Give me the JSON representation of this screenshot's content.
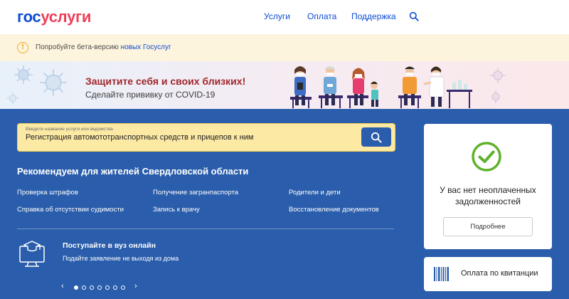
{
  "header": {
    "logo_part1": "гос",
    "logo_part2": "услуги",
    "nav": [
      "Услуги",
      "Оплата",
      "Поддержка"
    ],
    "search_icon": "search-icon"
  },
  "beta": {
    "icon": "exclamation-icon",
    "text": "Попробуйте бета-версию ",
    "link": "новых Госуслуг"
  },
  "banner": {
    "title": "Защитите себя и своих близких!",
    "subtitle": "Сделайте прививку от COVID-19"
  },
  "search": {
    "hint": "Введите название услуги или ведомства",
    "value": "Регистрация автомототранспортных средств и прицепов к ним",
    "button_icon": "search-icon"
  },
  "recommend": {
    "title": "Рекомендуем для жителей Свердловской области",
    "links": [
      "Проверка штрафов",
      "Получение загранпаспорта",
      "Родители и дети",
      "Справка об отсутствии судимости",
      "Запись к врачу",
      "Восстановление документов"
    ]
  },
  "promo": {
    "icon": "graduation-monitor-icon",
    "title": "Поступайте в вуз онлайн",
    "subtitle": "Подайте заявление не выходя из дома"
  },
  "pager": {
    "prev": "‹",
    "next": "›",
    "dots": 7,
    "active": 0
  },
  "debt_card": {
    "icon": "check-circle-icon",
    "text": "У вас нет неоплаченных задолженностей",
    "button": "Подробнее"
  },
  "receipt_card": {
    "icon": "barcode-icon",
    "text": "Оплата по квитанции"
  },
  "colors": {
    "brand_blue": "#0d4cd3",
    "brand_red": "#ee3f58",
    "panel_blue": "#2a5dab",
    "success_green": "#5fb22c",
    "warning_amber": "#f5a623"
  }
}
